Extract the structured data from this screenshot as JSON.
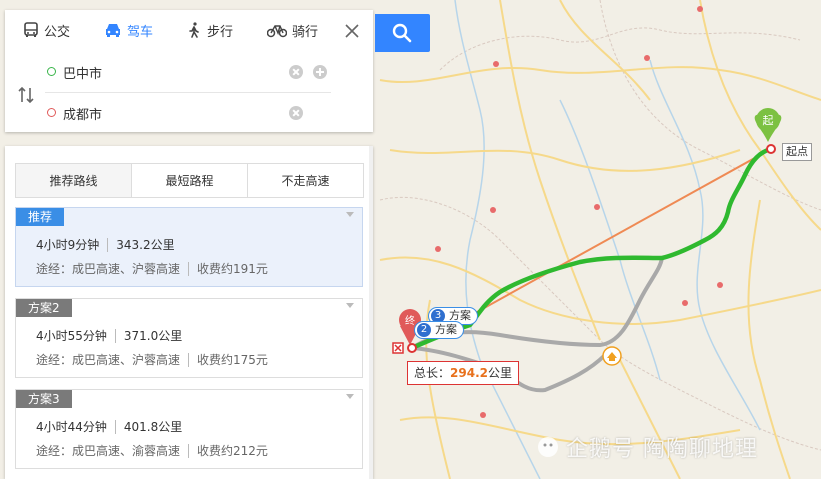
{
  "modes": [
    {
      "label": "公交",
      "icon": "bus-icon"
    },
    {
      "label": "驾车",
      "icon": "car-icon",
      "active": true
    },
    {
      "label": "步行",
      "icon": "walk-icon"
    },
    {
      "label": "骑行",
      "icon": "bike-icon"
    }
  ],
  "search": {
    "start_value": "巴中市",
    "end_value": "成都市",
    "search_icon": "search-icon"
  },
  "route_tabs": [
    "推荐路线",
    "最短路程",
    "不走高速"
  ],
  "routes": [
    {
      "badge": "推荐",
      "time": "4小时9分钟",
      "distance": "343.2公里",
      "via": "途经：成巴高速、沪蓉高速",
      "toll": "收费约191元"
    },
    {
      "badge": "方案2",
      "time": "4小时55分钟",
      "distance": "371.0公里",
      "via": "途经：成巴高速、沪蓉高速",
      "toll": "收费约175元"
    },
    {
      "badge": "方案3",
      "time": "4小时44分钟",
      "distance": "401.8公里",
      "via": "途经：成巴高速、渝蓉高速",
      "toll": "收费约212元"
    }
  ],
  "map": {
    "total_label": "总长：",
    "total_value": "294.2",
    "total_unit": "公里",
    "start_marker": "起",
    "start_label": "起点",
    "end_marker": "终",
    "plan_tag_3_num": "3",
    "plan_tag_3_text": "方案",
    "plan_tag_2_num": "2",
    "plan_tag_2_text": "方案",
    "watermark": "企鹅号 陶陶聊地理"
  },
  "colors": {
    "accent": "#3385ff",
    "route_green": "#2fb92f",
    "route_gray": "#a9a9a9",
    "callout_value": "#e8711d"
  }
}
